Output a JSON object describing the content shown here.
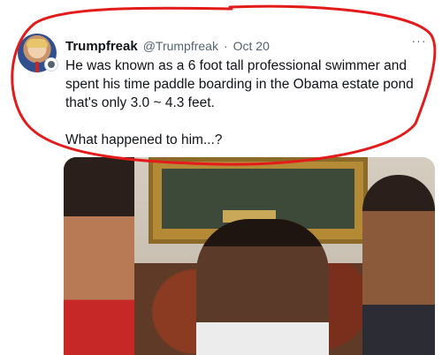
{
  "tweet": {
    "display_name": "Trumpfreak",
    "handle": "@Trumpfreak",
    "separator": "·",
    "date": "Oct 20",
    "more_label": "···",
    "text": "He was known as a 6 foot tall professional swimmer and spent his time paddle boarding in the Obama estate pond that's only 3.0 ~ 4.3 feet.\n\nWhat happened to him...?"
  },
  "colors": {
    "text_primary": "#0f1419",
    "text_secondary": "#536471",
    "annotation_red": "#e31b1b"
  },
  "icons": {
    "more": "more-horizontal-icon",
    "verified": "verified-badge-icon"
  }
}
